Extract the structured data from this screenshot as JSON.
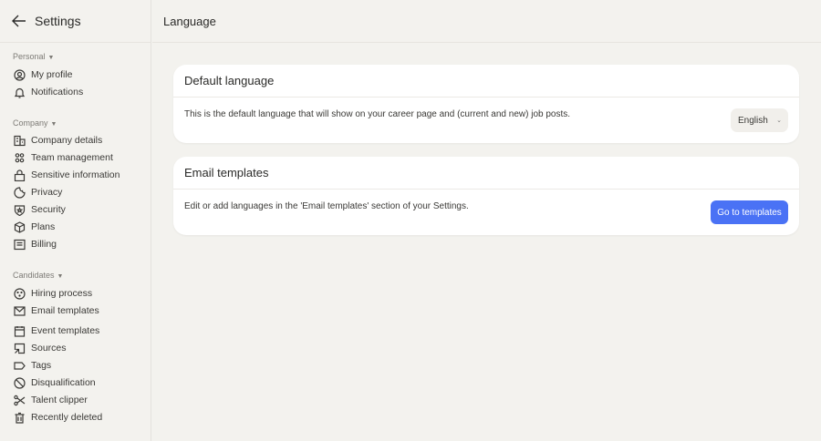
{
  "sidebar": {
    "title": "Settings",
    "sections": [
      {
        "label": "Personal",
        "items": [
          {
            "label": "My profile",
            "icon": "user-circle-icon"
          },
          {
            "label": "Notifications",
            "icon": "bell-icon"
          }
        ]
      },
      {
        "label": "Company",
        "items": [
          {
            "label": "Company details",
            "icon": "building-icon"
          },
          {
            "label": "Team management",
            "icon": "team-icon"
          },
          {
            "label": "Sensitive information",
            "icon": "lock-icon"
          },
          {
            "label": "Privacy",
            "icon": "cookie-icon"
          },
          {
            "label": "Security",
            "icon": "shield-icon"
          },
          {
            "label": "Plans",
            "icon": "box-icon"
          },
          {
            "label": "Billing",
            "icon": "receipt-icon"
          }
        ]
      },
      {
        "label": "Candidates",
        "items": [
          {
            "label": "Hiring process",
            "icon": "process-icon"
          },
          {
            "label": "Email templates",
            "icon": "envelope-icon"
          },
          {
            "label": "Event templates",
            "icon": "calendar-icon"
          },
          {
            "label": "Sources",
            "icon": "source-icon"
          },
          {
            "label": "Tags",
            "icon": "tag-icon"
          },
          {
            "label": "Disqualification",
            "icon": "ban-icon"
          },
          {
            "label": "Talent clipper",
            "icon": "scissors-icon"
          },
          {
            "label": "Recently deleted",
            "icon": "trash-icon"
          }
        ]
      }
    ]
  },
  "main": {
    "title": "Language",
    "default_language": {
      "title": "Default language",
      "description": "This is the default language that will show on your career page and (current and new) job posts.",
      "selected": "English"
    },
    "email_templates": {
      "title": "Email templates",
      "description": "Edit or add languages in the 'Email templates' section of your Settings.",
      "button": "Go to templates"
    }
  },
  "colors": {
    "accent": "#4a72f5",
    "background": "#f3f2ee"
  }
}
